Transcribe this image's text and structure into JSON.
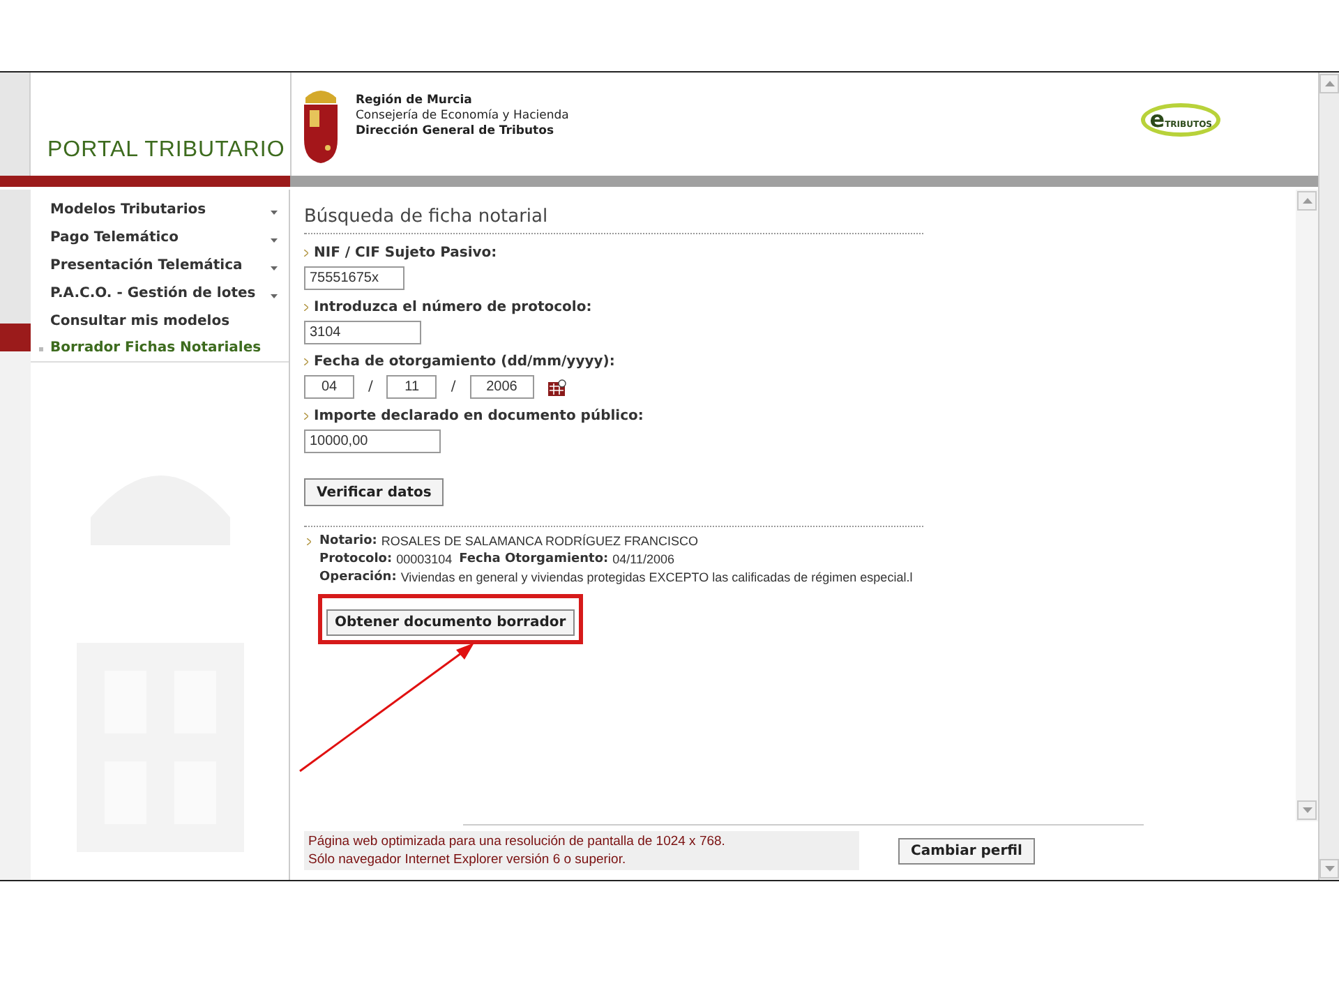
{
  "header": {
    "portal_title": "PORTAL TRIBUTARIO",
    "org_lines": [
      "Región de Murcia",
      "Consejería de Economía y Hacienda",
      "Dirección General de Tributos"
    ],
    "logo_letter": "e",
    "logo_text": "TRIBUTOS"
  },
  "sidebar": {
    "items": [
      {
        "label": "Modelos Tributarios",
        "dropdown": true,
        "selected": false
      },
      {
        "label": "Pago Telemático",
        "dropdown": true,
        "selected": false
      },
      {
        "label": "Presentación Telemática",
        "dropdown": true,
        "selected": false
      },
      {
        "label": "P.A.C.O. - Gestión de lotes",
        "dropdown": true,
        "selected": false
      },
      {
        "label": "Consultar mis modelos",
        "dropdown": false,
        "selected": false
      },
      {
        "label": "Borrador Fichas Notariales",
        "dropdown": false,
        "selected": true
      }
    ]
  },
  "form": {
    "title": "Búsqueda de ficha notarial",
    "fields": [
      {
        "kind": "text",
        "label": "NIF / CIF Sujeto Pasivo:",
        "value": "75551675x"
      },
      {
        "kind": "text",
        "label": "Introduzca el número de protocolo:",
        "value": "3104"
      },
      {
        "kind": "date",
        "label": "Fecha de otorgamiento (dd/mm/yyyy):",
        "parts": [
          "04",
          "11",
          "2006"
        ],
        "separators": [
          "/",
          "/"
        ]
      },
      {
        "kind": "text",
        "label": "Importe declarado en documento público:",
        "value": "10000,00"
      }
    ],
    "verify_button": "Verificar datos"
  },
  "result": {
    "lines": [
      [
        {
          "label": "Notario:",
          "value": "ROSALES DE SALAMANCA RODRÍGUEZ FRANCISCO"
        }
      ],
      [
        {
          "label": "Protocolo:",
          "value": "00003104"
        },
        {
          "label": "Fecha Otorgamiento:",
          "value": "04/11/2006"
        }
      ],
      [
        {
          "label": "Operación:",
          "value": "Viviendas en general y viviendas protegidas EXCEPTO las calificadas de régimen especial.l"
        }
      ]
    ],
    "draft_button": "Obtener documento borrador",
    "highlighted": true
  },
  "footer": {
    "notice_lines": [
      "Página web optimizada para una resolución de pantalla de 1024 x 768.",
      "Sólo navegador Internet Explorer versión 6 o superior."
    ],
    "profile_button": "Cambiar perfil"
  }
}
